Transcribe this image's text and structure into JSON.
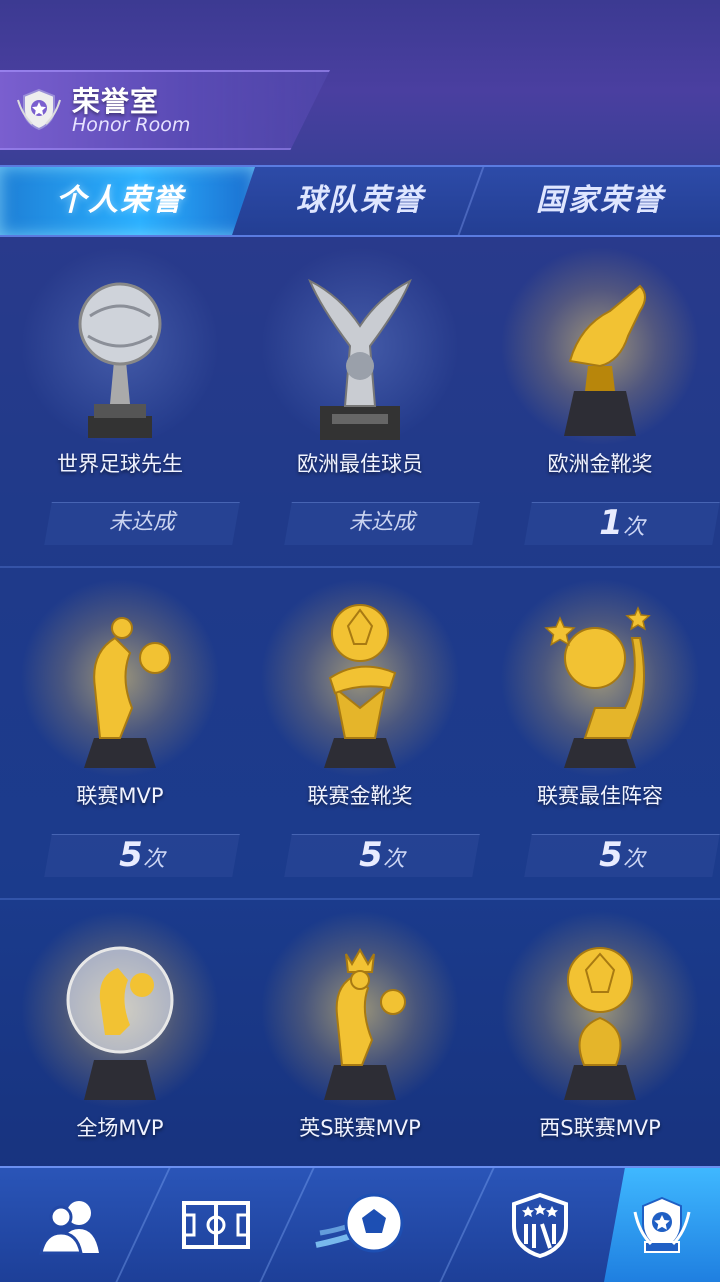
{
  "header": {
    "title_cn": "荣誉室",
    "title_en": "Honor Room",
    "icon": "trophy-badge-icon"
  },
  "tabs": [
    {
      "label": "个人荣誉",
      "active": true
    },
    {
      "label": "球队荣誉",
      "active": false
    },
    {
      "label": "国家荣誉",
      "active": false
    }
  ],
  "awards": [
    {
      "name": "世界足球先生",
      "status": "未达成",
      "count": null,
      "unit": "",
      "tier": "silver",
      "icon": "silver-ball-trophy-icon"
    },
    {
      "name": "欧洲最佳球员",
      "status": "未达成",
      "count": null,
      "unit": "",
      "tier": "silver",
      "icon": "silver-hands-trophy-icon"
    },
    {
      "name": "欧洲金靴奖",
      "status": "",
      "count": "1",
      "unit": "次",
      "tier": "gold",
      "icon": "golden-boot-trophy-icon"
    },
    {
      "name": "联赛MVP",
      "status": "",
      "count": "5",
      "unit": "次",
      "tier": "gold",
      "icon": "gold-player-trophy-icon"
    },
    {
      "name": "联赛金靴奖",
      "status": "",
      "count": "5",
      "unit": "次",
      "tier": "gold",
      "icon": "gold-boot-ball-trophy-icon"
    },
    {
      "name": "联赛最佳阵容",
      "status": "",
      "count": "5",
      "unit": "次",
      "tier": "gold",
      "icon": "gold-star-ball-trophy-icon"
    },
    {
      "name": "全场MVP",
      "status": "",
      "count": null,
      "unit": "",
      "tier": "crystal",
      "icon": "crystal-ball-trophy-icon"
    },
    {
      "name": "英S联赛MVP",
      "status": "",
      "count": null,
      "unit": "",
      "tier": "gold",
      "icon": "gold-crown-player-trophy-icon"
    },
    {
      "name": "西S联赛MVP",
      "status": "",
      "count": null,
      "unit": "",
      "tier": "gold",
      "icon": "gold-ball-twist-trophy-icon"
    }
  ],
  "bottom_nav": [
    {
      "icon": "players-icon",
      "active": false
    },
    {
      "icon": "field-icon",
      "active": false
    },
    {
      "icon": "soccer-ball-icon",
      "active": false
    },
    {
      "icon": "club-badge-icon",
      "active": false
    },
    {
      "icon": "trophy-badge-icon",
      "active": true
    }
  ],
  "colors": {
    "accent": "#2ab0ff",
    "gold": "#f2c233",
    "panel": "#5a4bb5"
  }
}
